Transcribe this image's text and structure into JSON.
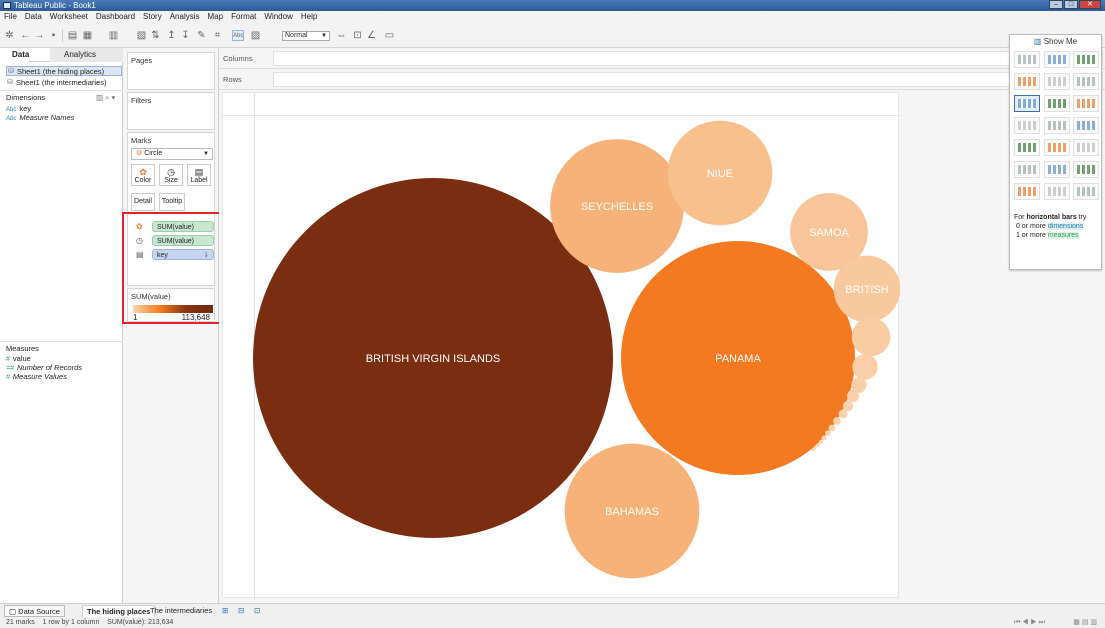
{
  "window": {
    "title": "Tableau Public - Book1"
  },
  "menu": [
    "File",
    "Data",
    "Worksheet",
    "Dashboard",
    "Story",
    "Analysis",
    "Map",
    "Format",
    "Window",
    "Help"
  ],
  "toolbar": {
    "fit_select": "Normal"
  },
  "data_pane": {
    "tabs": [
      "Data",
      "Analytics"
    ],
    "sources": [
      "Sheet1 (the hiding places)",
      "Sheet1 (the intermediaries)"
    ],
    "dimensions_label": "Dimensions",
    "dimensions": [
      {
        "type": "Abc",
        "name": "key"
      },
      {
        "type": "Abc",
        "name": "Measure Names"
      }
    ],
    "measures_label": "Measures",
    "measures": [
      {
        "type": "#",
        "name": "value"
      },
      {
        "type": "=#",
        "name": "Number of Records"
      },
      {
        "type": "#",
        "name": "Measure Values"
      }
    ]
  },
  "cards": {
    "pages": "Pages",
    "filters": "Filters",
    "marks": "Marks",
    "mark_type": "Circle",
    "mark_buttons": [
      "Color",
      "Size",
      "Label",
      "Detail",
      "Tooltip"
    ],
    "pills": [
      "SUM(value)",
      "SUM(value)",
      "key"
    ],
    "legend_title": "SUM(value)",
    "legend_min": "1",
    "legend_max": "113,648"
  },
  "shelves": {
    "columns": "Columns",
    "rows": "Rows"
  },
  "show_me": {
    "title": "Show Me",
    "hint_prefix": "For",
    "hint_bold": "horizontal bars",
    "hint_suffix": "try",
    "line1_prefix": "0 or more",
    "line1_link": "dimensions",
    "line2_prefix": "1 or more",
    "line2_link": "measures"
  },
  "sheet_tabs": {
    "data_source": "Data Source",
    "tabs": [
      "The hiding places",
      "The intermediaries"
    ]
  },
  "status": {
    "marks": "21 marks",
    "layout": "1 row by 1 column",
    "sum": "SUM(value): 213,634"
  },
  "chart_data": {
    "type": "packed-bubble",
    "color_scale": {
      "min_color": "#fbd5ae",
      "max_color": "#7b2d12"
    },
    "bubbles": [
      {
        "label": "BRITISH VIRGIN ISLANDS",
        "value": 113648,
        "color": "#7b2d12"
      },
      {
        "label": "PANAMA",
        "value": 48000,
        "color": "#f47a22"
      },
      {
        "label": "BAHAMAS",
        "value": 15900,
        "color": "#f6b278"
      },
      {
        "label": "SEYCHELLES",
        "value": 15700,
        "color": "#f6b278"
      },
      {
        "label": "NIUE",
        "value": 9600,
        "color": "#f8c08c"
      },
      {
        "label": "SAMOA",
        "value": 5300,
        "color": "#f8c59a"
      },
      {
        "label": "BRITISH",
        "value": 3900,
        "color": "#f8c89e"
      },
      {
        "label": "",
        "value": 1300,
        "color": "#f9cca4"
      },
      {
        "label": "",
        "value": 570,
        "color": "#f9cea8"
      },
      {
        "label": "",
        "value": 210,
        "color": "#fad0ab"
      },
      {
        "label": "",
        "value": 130,
        "color": "#fad0ab"
      },
      {
        "label": "",
        "value": 95,
        "color": "#fad2ae"
      },
      {
        "label": "",
        "value": 70,
        "color": "#fad2ae"
      },
      {
        "label": "",
        "value": 52,
        "color": "#fad3b0"
      },
      {
        "label": "",
        "value": 40,
        "color": "#fad3b0"
      },
      {
        "label": "",
        "value": 30,
        "color": "#fbd4b1"
      },
      {
        "label": "",
        "value": 22,
        "color": "#fbd4b1"
      },
      {
        "label": "",
        "value": 16,
        "color": "#fbd5b2"
      },
      {
        "label": "",
        "value": 11,
        "color": "#fbd5b2"
      },
      {
        "label": "",
        "value": 6,
        "color": "#fbd5b3"
      },
      {
        "label": "",
        "value": 1,
        "color": "#fbd5b3"
      }
    ]
  }
}
